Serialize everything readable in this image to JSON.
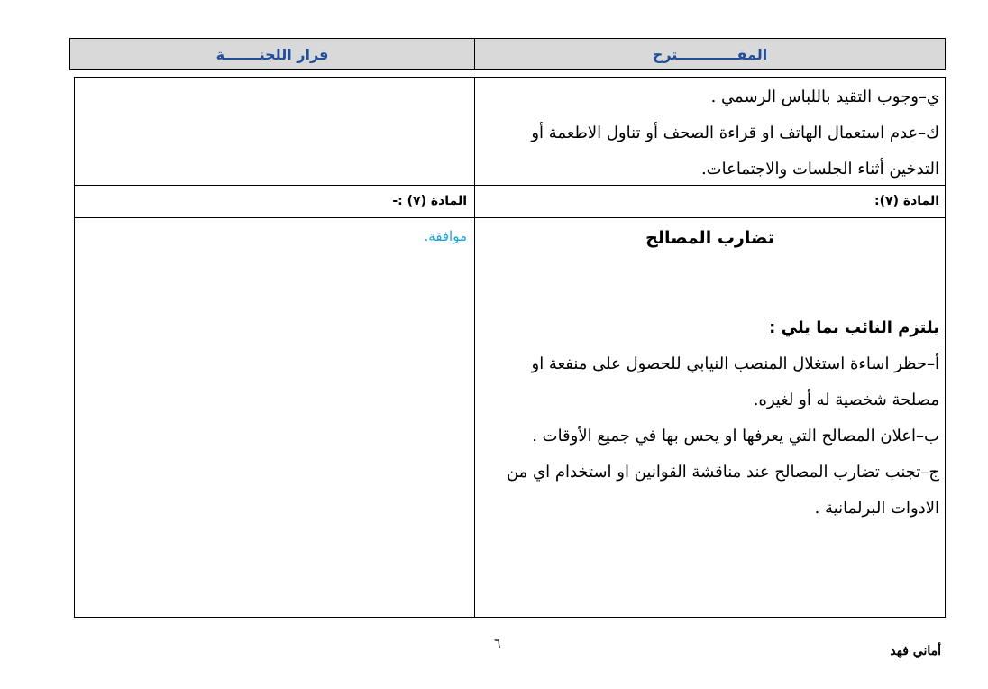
{
  "header": {
    "proposal": "المقــــــــــــترح",
    "committee_decision": "قرار اللجنـــــــة"
  },
  "row1": {
    "lines": [
      "ي–وجوب التقيد باللباس الرسمي .",
      "ك–عدم استعمال الهاتف او قراءة الصحف  أو تناول الاطعمة  أو",
      "التدخين  أثناء الجلسات والاجتماعات."
    ]
  },
  "row2": {
    "proposal_article": "المادة (٧):",
    "decision_article": "المادة (٧) :-"
  },
  "row3": {
    "title": "تضارب المصالح",
    "intro": "يلتزم النائب بما يلي :",
    "lines": [
      "أ–حظر اساءة استغلال المنصب النيابي للحصول على منفعة او",
      "مصلحة شخصية له أو لغيره.",
      "ب–اعلان المصالح التي يعرفها او يحس بها في جميع الأوقات .",
      "ج–تجنب تضارب المصالح عند مناقشة القوانين او استخدام اي من",
      "الادوات البرلمانية ."
    ],
    "decision": "موافقة."
  },
  "footer": {
    "page_number": "٦",
    "signature": "أماني فهد"
  }
}
